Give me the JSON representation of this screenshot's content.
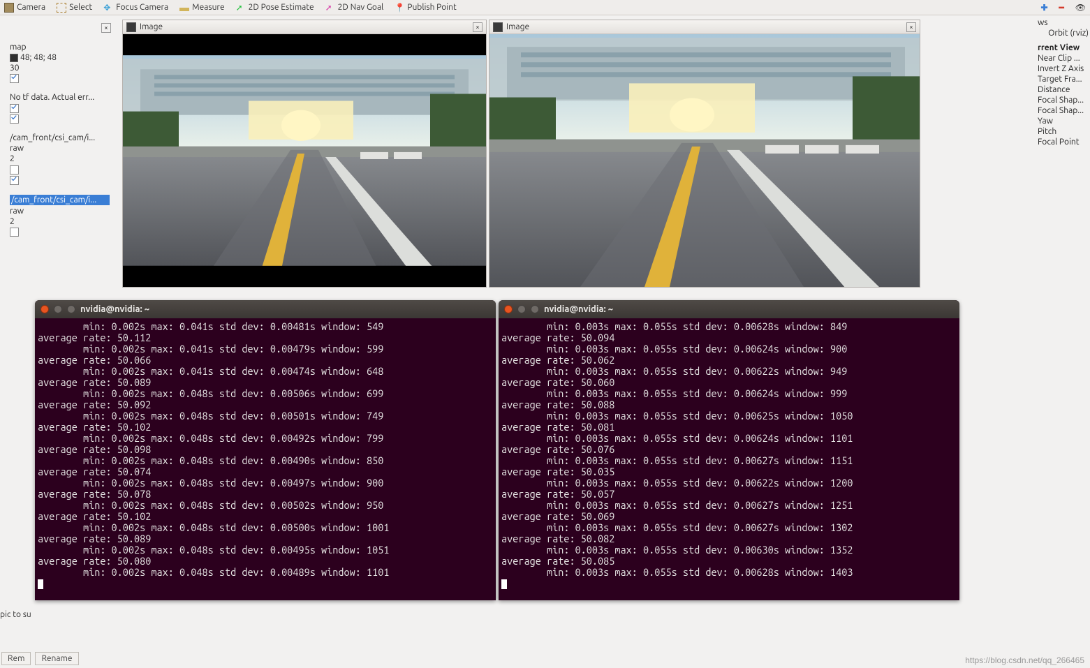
{
  "toolbar": {
    "camera": "Camera",
    "select": "Select",
    "focus": "Focus Camera",
    "measure": "Measure",
    "pose": "2D Pose Estimate",
    "nav": "2D Nav Goal",
    "publish": "Publish Point"
  },
  "left_panel": {
    "fixed_frame": "map",
    "color": "48; 48; 48",
    "alpha": "30",
    "tf_status": "No tf data.  Actual err...",
    "image_topic": "/cam_front/csi_cam/i...",
    "transport1": "raw",
    "queue1": "2",
    "image_topic2": "/cam_front/csi_cam/i...",
    "transport2": "raw",
    "queue2": "2"
  },
  "image_pane": {
    "title": "Image"
  },
  "right_panel": {
    "head_ws": "ws",
    "orbit": "Orbit (rviz)",
    "head_view": "rrent View",
    "items": [
      "Near Clip ...",
      "Invert Z Axis",
      "Target Fra...",
      "Distance",
      "Focal Shap...",
      "Focal Shap...",
      "Yaw",
      "Pitch",
      "Focal Point"
    ]
  },
  "terminal_left": {
    "title": "nvidia@nvidia: ~",
    "lines": [
      "        min: 0.002s max: 0.041s std dev: 0.00481s window: 549",
      "average rate: 50.112",
      "        min: 0.002s max: 0.041s std dev: 0.00479s window: 599",
      "average rate: 50.066",
      "        min: 0.002s max: 0.041s std dev: 0.00474s window: 648",
      "average rate: 50.089",
      "        min: 0.002s max: 0.048s std dev: 0.00506s window: 699",
      "average rate: 50.092",
      "        min: 0.002s max: 0.048s std dev: 0.00501s window: 749",
      "average rate: 50.102",
      "        min: 0.002s max: 0.048s std dev: 0.00492s window: 799",
      "average rate: 50.098",
      "        min: 0.002s max: 0.048s std dev: 0.00490s window: 850",
      "average rate: 50.074",
      "        min: 0.002s max: 0.048s std dev: 0.00497s window: 900",
      "average rate: 50.078",
      "        min: 0.002s max: 0.048s std dev: 0.00502s window: 950",
      "average rate: 50.102",
      "        min: 0.002s max: 0.048s std dev: 0.00500s window: 1001",
      "average rate: 50.089",
      "        min: 0.002s max: 0.048s std dev: 0.00495s window: 1051",
      "average rate: 50.080",
      "        min: 0.002s max: 0.048s std dev: 0.00489s window: 1101"
    ]
  },
  "terminal_right": {
    "title": "nvidia@nvidia: ~",
    "lines": [
      "        min: 0.003s max: 0.055s std dev: 0.00628s window: 849",
      "average rate: 50.094",
      "        min: 0.003s max: 0.055s std dev: 0.00624s window: 900",
      "average rate: 50.062",
      "        min: 0.003s max: 0.055s std dev: 0.00622s window: 949",
      "average rate: 50.060",
      "        min: 0.003s max: 0.055s std dev: 0.00624s window: 999",
      "average rate: 50.088",
      "        min: 0.003s max: 0.055s std dev: 0.00625s window: 1050",
      "average rate: 50.081",
      "        min: 0.003s max: 0.055s std dev: 0.00624s window: 1101",
      "average rate: 50.076",
      "        min: 0.003s max: 0.055s std dev: 0.00627s window: 1151",
      "average rate: 50.035",
      "        min: 0.003s max: 0.055s std dev: 0.00622s window: 1200",
      "average rate: 50.057",
      "        min: 0.003s max: 0.055s std dev: 0.00627s window: 1251",
      "average rate: 50.069",
      "        min: 0.003s max: 0.055s std dev: 0.00627s window: 1302",
      "average rate: 50.082",
      "        min: 0.003s max: 0.055s std dev: 0.00630s window: 1352",
      "average rate: 50.085",
      "        min: 0.003s max: 0.055s std dev: 0.00628s window: 1403"
    ]
  },
  "bottom": {
    "topic_text": "pic to su",
    "remove": "Rem",
    "rename": "Rename",
    "watermark": "https://blog.csdn.net/qq_266465"
  }
}
